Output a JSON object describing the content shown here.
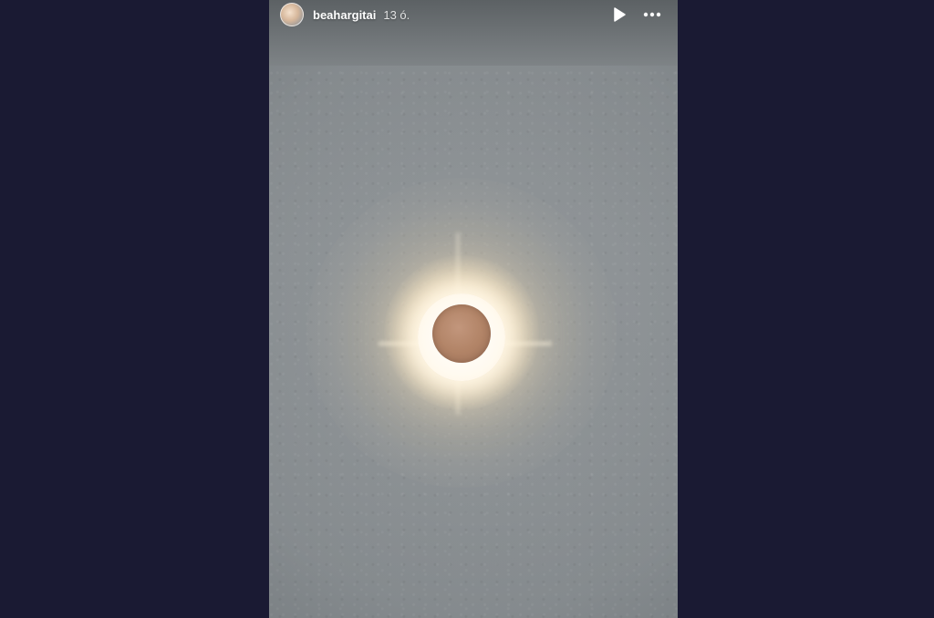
{
  "story": {
    "username": "beahargitai",
    "time": "13 ó.",
    "icons": {
      "play": "play-icon",
      "more": "more-options-icon",
      "avatar": "profile-avatar"
    }
  },
  "colors": {
    "page_background": "#1a1a33",
    "text": "#ffffff"
  }
}
